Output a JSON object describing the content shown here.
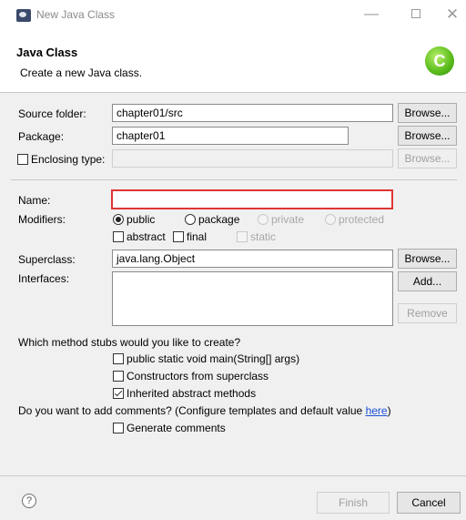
{
  "window": {
    "title": "New Java Class",
    "minimize": "—",
    "close": "✕"
  },
  "header": {
    "title": "Java Class",
    "description": "Create a new Java class.",
    "logo_letter": "C"
  },
  "source_folder": {
    "label": "Source folder:",
    "value": "chapter01/src",
    "browse": "Browse..."
  },
  "package": {
    "label": "Package:",
    "value": "chapter01",
    "browse": "Browse..."
  },
  "enclosing_type": {
    "label": "Enclosing type:",
    "value": "",
    "browse": "Browse..."
  },
  "name": {
    "label": "Name:",
    "value": ""
  },
  "modifiers": {
    "label": "Modifiers:",
    "access": [
      "public",
      "package",
      "private",
      "protected"
    ],
    "selected": "public",
    "flags": [
      "abstract",
      "final",
      "static"
    ]
  },
  "superclass": {
    "label": "Superclass:",
    "value": "java.lang.Object",
    "browse": "Browse..."
  },
  "interfaces": {
    "label": "Interfaces:",
    "add": "Add...",
    "remove": "Remove"
  },
  "stubs": {
    "question": "Which method stubs would you like to create?",
    "options": [
      {
        "label": "public static void main(String[] args)",
        "checked": false
      },
      {
        "label": "Constructors from superclass",
        "checked": false
      },
      {
        "label": "Inherited abstract methods",
        "checked": true
      }
    ]
  },
  "comments": {
    "question": "Do you want to add comments? (Configure templates and default value ",
    "link": "here",
    "suffix": ")",
    "generate": "Generate comments",
    "checked": false
  },
  "footer": {
    "help": "?",
    "finish": "Finish",
    "cancel": "Cancel"
  },
  "colors": {
    "error_border": "#e03535",
    "link": "#1a4fd6",
    "logo": "#5fbf1e"
  }
}
